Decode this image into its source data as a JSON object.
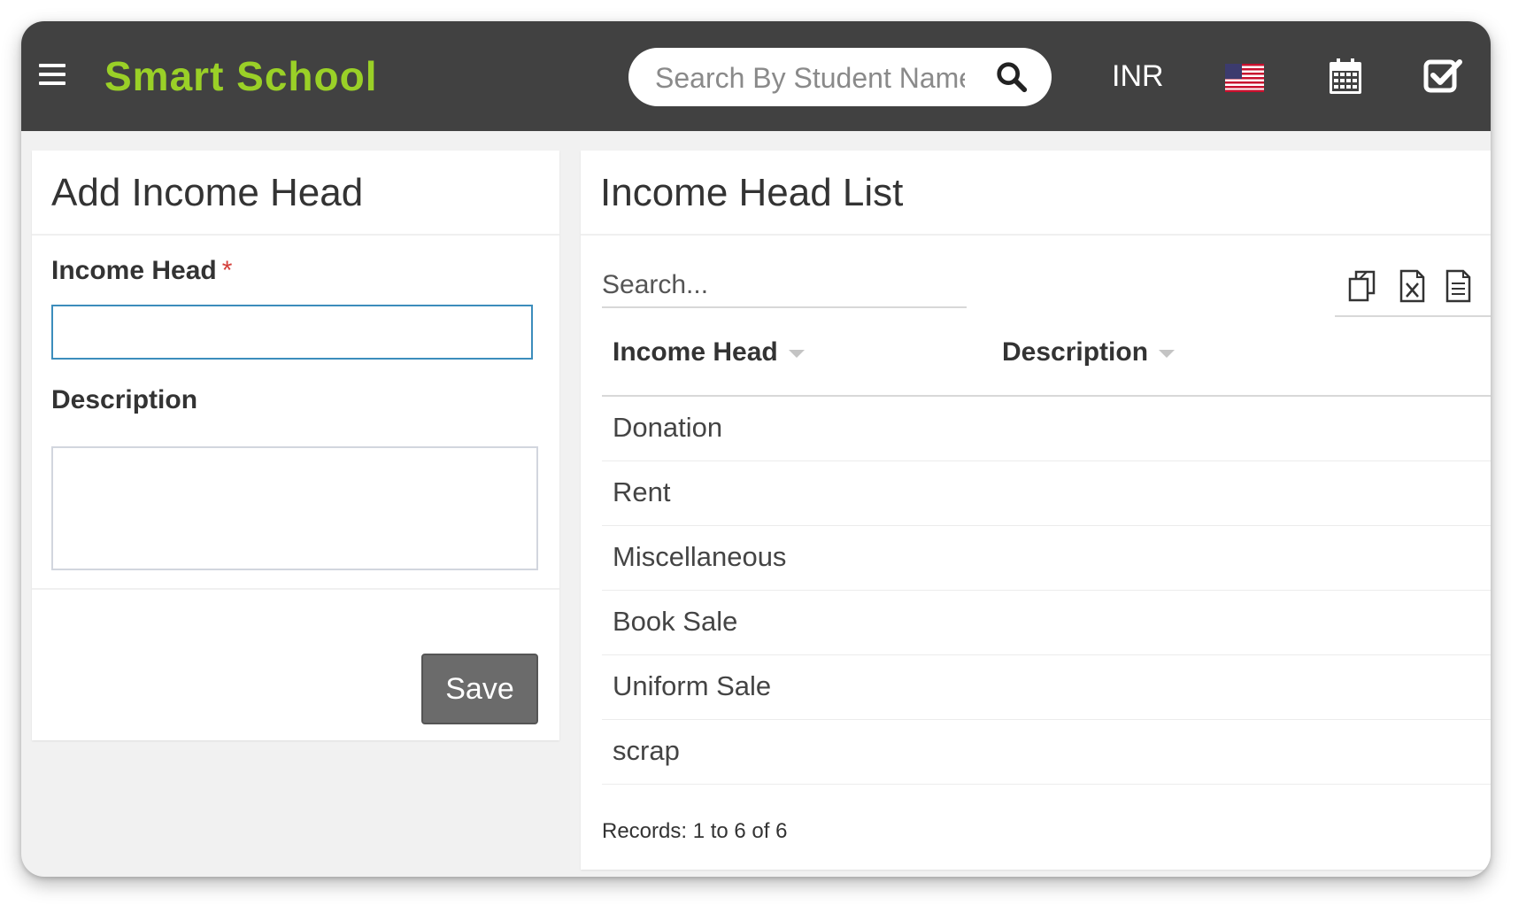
{
  "header": {
    "brand": "Smart School",
    "search_placeholder": "Search By Student Name",
    "currency": "INR",
    "icons": [
      "menu-icon",
      "search-icon",
      "us-flag-icon",
      "calendar-icon",
      "check-square-icon"
    ]
  },
  "add_form": {
    "title": "Add Income Head",
    "income_head_label": "Income Head",
    "required_mark": "*",
    "income_head_value": "",
    "description_label": "Description",
    "description_value": "",
    "save_label": "Save"
  },
  "list": {
    "title": "Income Head List",
    "search_placeholder": "Search...",
    "tools": [
      "copy-icon",
      "excel-icon",
      "csv-icon"
    ],
    "columns": [
      "Income Head",
      "Description"
    ],
    "rows": [
      {
        "income_head": "Donation",
        "description": ""
      },
      {
        "income_head": "Rent",
        "description": ""
      },
      {
        "income_head": "Miscellaneous",
        "description": ""
      },
      {
        "income_head": "Book Sale",
        "description": ""
      },
      {
        "income_head": "Uniform Sale",
        "description": ""
      },
      {
        "income_head": "scrap",
        "description": ""
      }
    ],
    "records": "Records: 1 to 6 of 6"
  },
  "colors": {
    "brand": "#9ad027",
    "topbar": "#414141",
    "input_focus": "#3c8dbc",
    "required": "#d43f3a",
    "save_button": "#6b6b6b"
  }
}
